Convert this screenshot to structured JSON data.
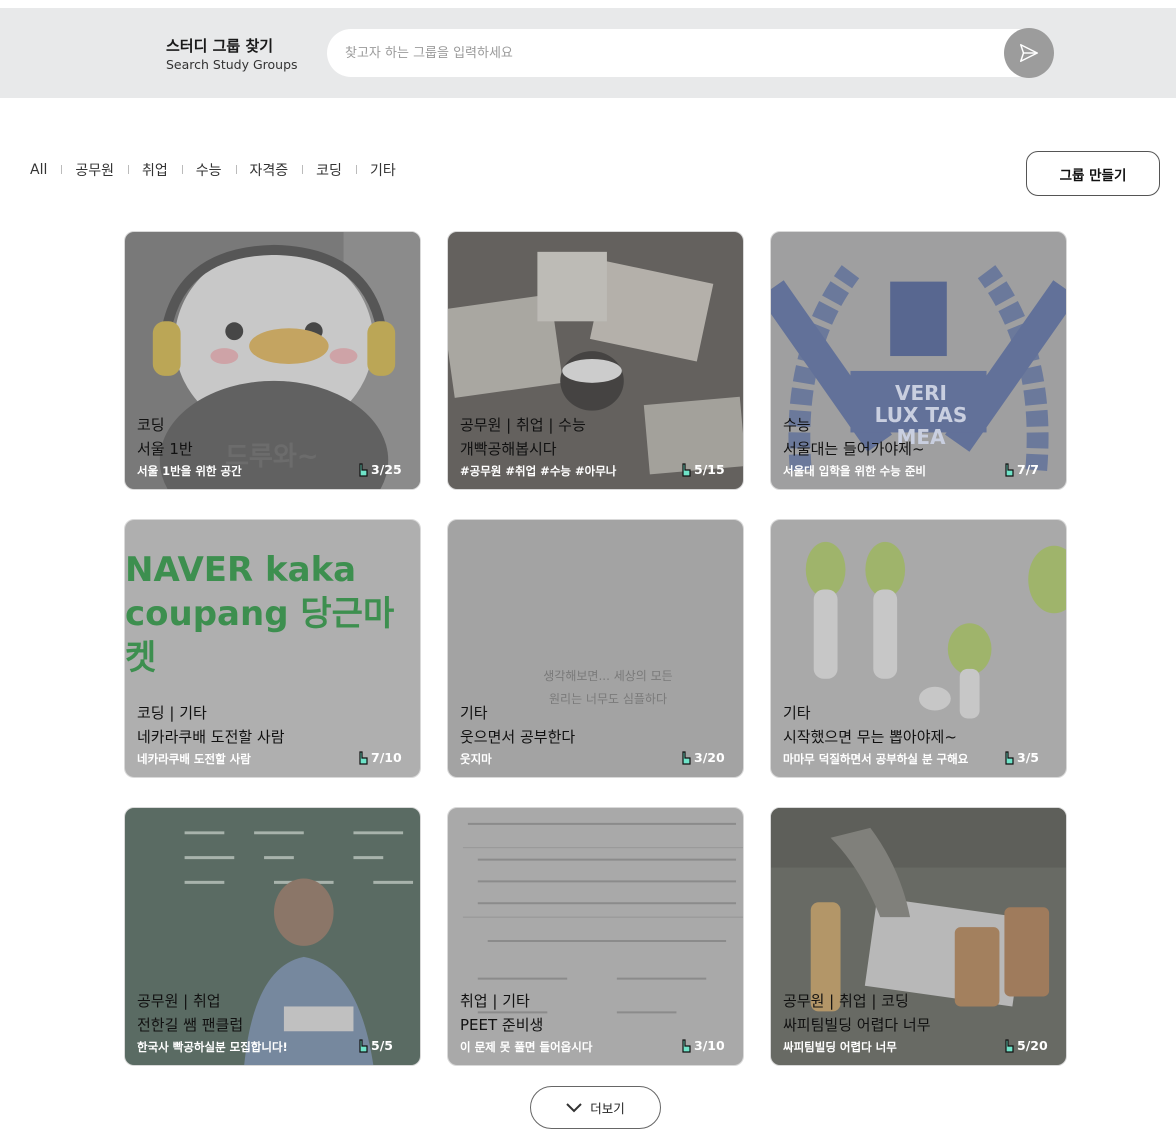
{
  "header": {
    "title_ko": "스터디 그룹 찾기",
    "title_en": "Search Study Groups",
    "search_placeholder": "찾고자 하는 그룹을 입력하세요",
    "search_icon": "send-icon"
  },
  "filters": [
    "All",
    "공무원",
    "취업",
    "수능",
    "자격증",
    "코딩",
    "기타"
  ],
  "create_button": "그룹 만들기",
  "cards": [
    {
      "category": "코딩",
      "title": "서울 1반",
      "desc": "서울 1반을 위한 공간",
      "count": "3/25",
      "image_text": "드루와~",
      "bg": "#7a7a7a"
    },
    {
      "category": "공무원 | 취업 | 수능",
      "title": "개빡공해봅시다",
      "desc": "#공무원 #취업 #수능 #아무나",
      "count": "5/15",
      "bg": "#5e5a55"
    },
    {
      "category": "수능",
      "title": "서울대는 들어가야제~",
      "desc": "서울대 입학을 위한 수능 준비",
      "count": "7/7",
      "image_text": "VERI LUX TAS MEA",
      "bg": "#a4a4a6"
    },
    {
      "category": "코딩 | 기타",
      "title": "네카라쿠배 도전할 사람",
      "desc": "네카라쿠배 도전할 사람",
      "count": "7/10",
      "image_text": "NAVER kaka coupang 당근마켓",
      "bg": "#bfbfbf"
    },
    {
      "category": "기타",
      "title": "웃으면서 공부한다",
      "desc": "웃지마",
      "count": "3/20",
      "image_text": "생각해보면... 세상의 모든 원리는 너무도 심플하다",
      "bg": "#a9a9a9"
    },
    {
      "category": "기타",
      "title": "시작했으면 무는 뽑아야제~",
      "desc": "마마무 덕질하면서 공부하실 분 구해요",
      "count": "3/5",
      "bg": "#b2b2b2"
    },
    {
      "category": "공무원 | 취업",
      "title": "전한길 쌤 팬클럽",
      "desc": "한국사 빡공하실분 모집합니다!",
      "count": "5/5",
      "bg": "#4d5e56"
    },
    {
      "category": "취업 | 기타",
      "title": "PEET 준비생",
      "desc": "이 문제 못 풀면 들어옵시다",
      "count": "3/10",
      "bg": "#b4b4b4"
    },
    {
      "category": "공무원 | 취업 | 코딩",
      "title": "싸피팀빌딩 어렵다 너무",
      "desc": "싸피팀빌딩 어렵다 너무",
      "count": "5/20",
      "bg": "#5f625a"
    }
  ],
  "more_button": "더보기"
}
